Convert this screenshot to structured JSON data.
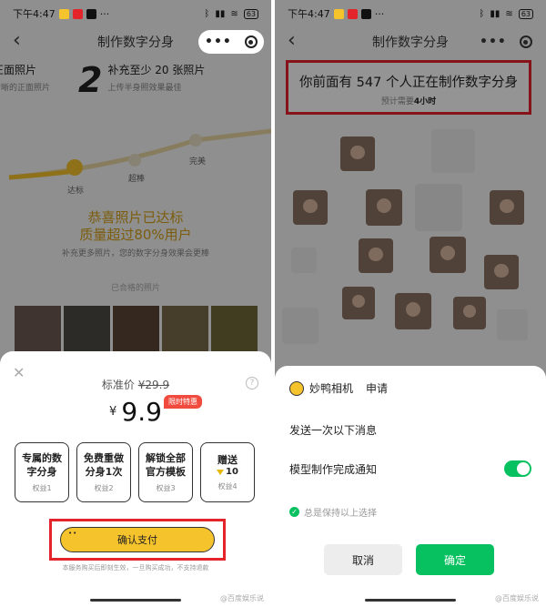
{
  "left": {
    "status_time": "下午4:47",
    "battery": "63",
    "nav_title": "制作数字分身",
    "steps": [
      {
        "num": "",
        "title": "正面照片",
        "sub": "清晰的正面照片"
      },
      {
        "num": "2",
        "title": "补充至少 20 张照片",
        "sub": "上传半身照效果最佳"
      }
    ],
    "levels": [
      "达标",
      "超棒",
      "完美"
    ],
    "congrats_line1": "恭喜照片已达标",
    "congrats_line2": "质量超过80%用户",
    "hint": "补充更多照片，您的数字分身效果会更棒",
    "qualified_label": "已合格的照片",
    "sheet": {
      "help": "?",
      "std_label": "标准价",
      "std_price": "¥29.9",
      "currency": "¥",
      "price": "9.9",
      "promo": "限时特惠",
      "benefits": [
        {
          "title": "专属的数字分身",
          "sub": "权益1"
        },
        {
          "title": "免费重做分身1次",
          "sub": "权益2"
        },
        {
          "title": "解锁全部官方模板",
          "sub": "权益3"
        },
        {
          "title": "赠送",
          "count": "10",
          "sub": "权益4"
        }
      ],
      "pay_button": "确认支付",
      "disclaimer": "本服务购买后即刻生效，一旦购买成功，不支持退款"
    }
  },
  "right": {
    "status_time": "下午4:47",
    "battery": "63",
    "nav_title": "制作数字分身",
    "queue_prefix": "你前面有 ",
    "queue_count": "547",
    "queue_suffix": " 个人正在制作数字分身",
    "eta_prefix": "预计需要",
    "eta_value": "4小时",
    "auth": {
      "app_name": "妙鸭相机",
      "action": "申请",
      "send_text": "发送一次以下消息",
      "notify_label": "模型制作完成通知",
      "keep_label": "总是保持以上选择",
      "cancel": "取消",
      "confirm": "确定"
    }
  },
  "watermark": "@百度娱乐说"
}
